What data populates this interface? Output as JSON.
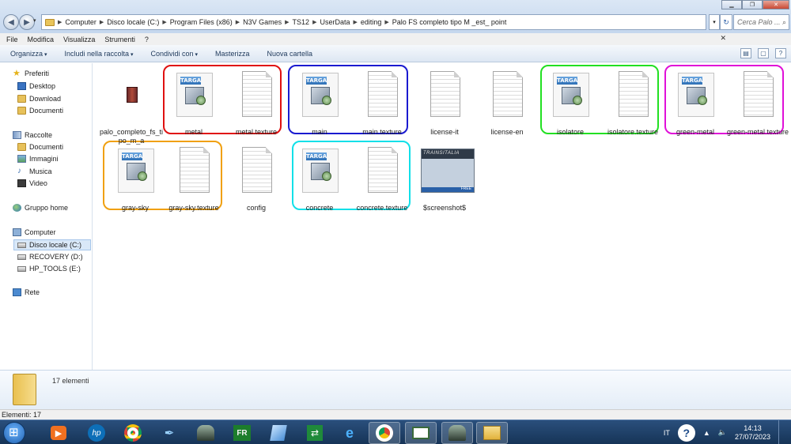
{
  "window": {
    "breadcrumb": [
      "Computer",
      "Disco locale (C:)",
      "Program Files (x86)",
      "N3V Games",
      "TS12",
      "UserData",
      "editing",
      "Palo FS completo tipo M _est_ point"
    ],
    "search_placeholder": "Cerca Palo ..."
  },
  "menu": [
    "File",
    "Modifica",
    "Visualizza",
    "Strumenti",
    "?"
  ],
  "commands": {
    "organize": "Organizza",
    "include": "Includi nella raccolta",
    "share": "Condividi con",
    "burn": "Masterizza",
    "new_folder": "Nuova cartella"
  },
  "sidebar": {
    "favorites": "Preferiti",
    "desktop": "Desktop",
    "download": "Download",
    "documents": "Documenti",
    "libraries": "Raccolte",
    "lib_documents": "Documenti",
    "lib_images": "Immagini",
    "lib_music": "Musica",
    "lib_video": "Video",
    "homegroup": "Gruppo home",
    "computer": "Computer",
    "drive_c": "Disco locale (C:)",
    "drive_d": "RECOVERY (D:)",
    "drive_e": "HP_TOOLS (E:)",
    "network": "Rete"
  },
  "files": {
    "palo": "palo_completo_fs_tipo_m_a",
    "metal": "metal",
    "metal_texture": "metal.texture",
    "main": "main",
    "main_texture": "main.texture",
    "license_it": "license-it",
    "license_en": "license-en",
    "isolatore": "isolatore",
    "isolatore_texture": "isolatore.texture",
    "green_metal": "green-metal",
    "green_metal_texture": "green-metal.texture",
    "gray_sky": "gray-sky",
    "gray_sky_texture": "gray-sky.texture",
    "config": "config",
    "concrete": "concrete",
    "concrete_texture": "concrete.texture",
    "screenshot": "$screenshot$"
  },
  "thumb_text": {
    "targa": "TARGA",
    "trainsitalia": "TRAINSITALIA",
    "free": "FREE"
  },
  "highlight_colors": {
    "metal": "#e01010",
    "main": "#1a1ad0",
    "isolatore": "#22e022",
    "green_metal": "#e010d8",
    "gray_sky": "#f0a010",
    "concrete": "#10e0e8"
  },
  "details": {
    "count": "17 elementi"
  },
  "status": {
    "text": "Elementi: 17"
  },
  "tray": {
    "lang": "IT",
    "time": "14:13",
    "date": "27/07/2023"
  }
}
